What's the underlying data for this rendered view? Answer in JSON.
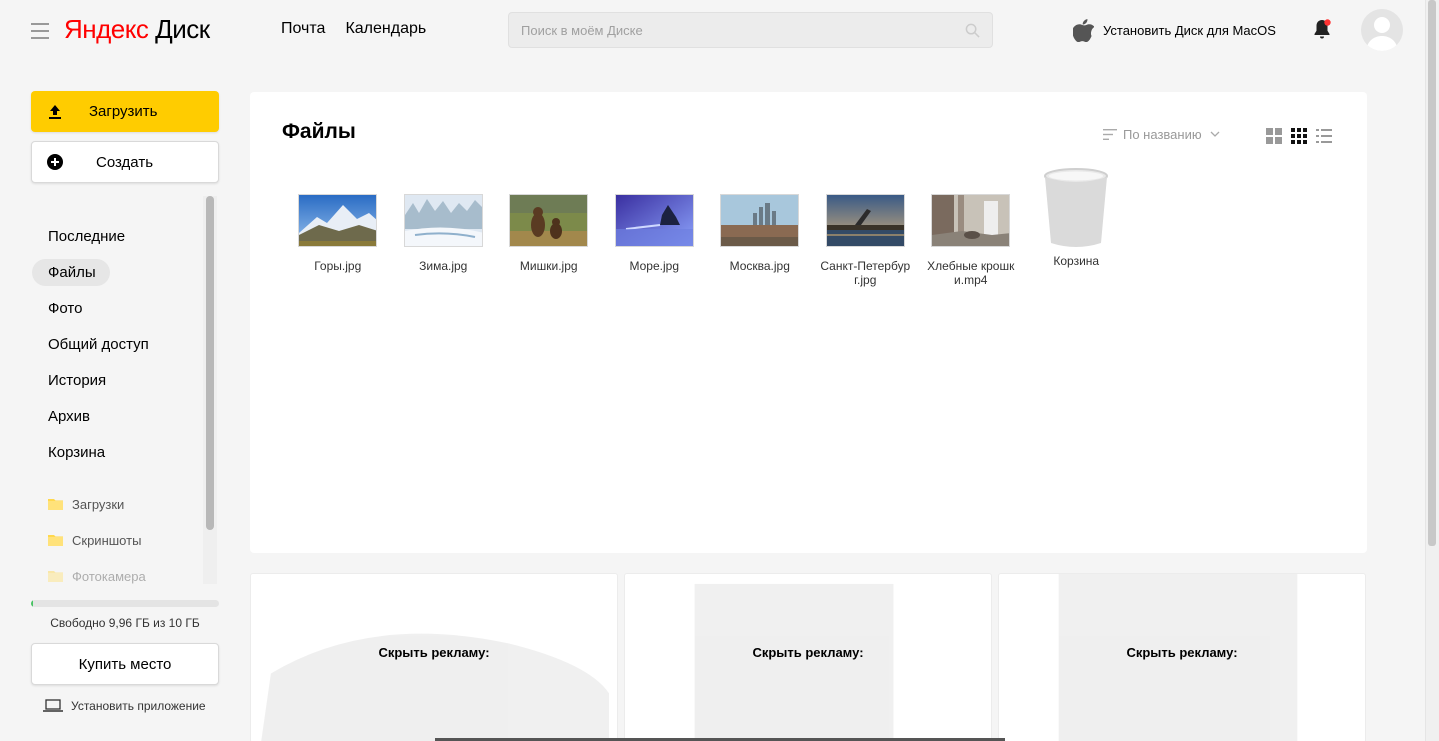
{
  "header": {
    "logo_ya": "Яндекс",
    "logo_disk": "Диск",
    "nav": [
      "Почта",
      "Календарь"
    ],
    "search_placeholder": "Поиск в моём Диске",
    "install_mac": "Установить Диск для MacOS",
    "icons": [
      "menu-icon",
      "search-icon",
      "apple-icon",
      "bell-icon",
      "avatar"
    ]
  },
  "sidebar": {
    "upload_label": "Загрузить",
    "create_label": "Создать",
    "items": [
      {
        "label": "Последние"
      },
      {
        "label": "Файлы",
        "active": true
      },
      {
        "label": "Фото"
      },
      {
        "label": "Общий доступ"
      },
      {
        "label": "История"
      },
      {
        "label": "Архив"
      },
      {
        "label": "Корзина"
      }
    ],
    "folders": [
      "Загрузки",
      "Скриншоты",
      "Фотокамера"
    ],
    "quota_text": "Свободно 9,96 ГБ из 10 ГБ",
    "quota_used_fraction": 0.004,
    "buy_label": "Купить место",
    "install_app": "Установить приложение"
  },
  "main": {
    "title": "Файлы",
    "sort_label": "По названию",
    "views": [
      "large-tiles-icon",
      "small-tiles-icon",
      "list-view-icon"
    ],
    "files": [
      {
        "name": "Горы.jpg"
      },
      {
        "name": "Зима.jpg"
      },
      {
        "name": "Мишки.jpg"
      },
      {
        "name": "Море.jpg"
      },
      {
        "name": "Москва.jpg"
      },
      {
        "name": "Санкт-Петербург.jpg"
      },
      {
        "name": "Хлебные крошки.mp4"
      },
      {
        "name": "Корзина"
      }
    ]
  },
  "ads": [
    {
      "hide_label": "Скрыть рекламу:"
    },
    {
      "hide_label": "Скрыть рекламу:"
    },
    {
      "hide_label": "Скрыть рекламу:"
    }
  ],
  "colors": {
    "accent": "#ffcc00",
    "quota": "#49c264",
    "logo_red": "#ff0000"
  }
}
